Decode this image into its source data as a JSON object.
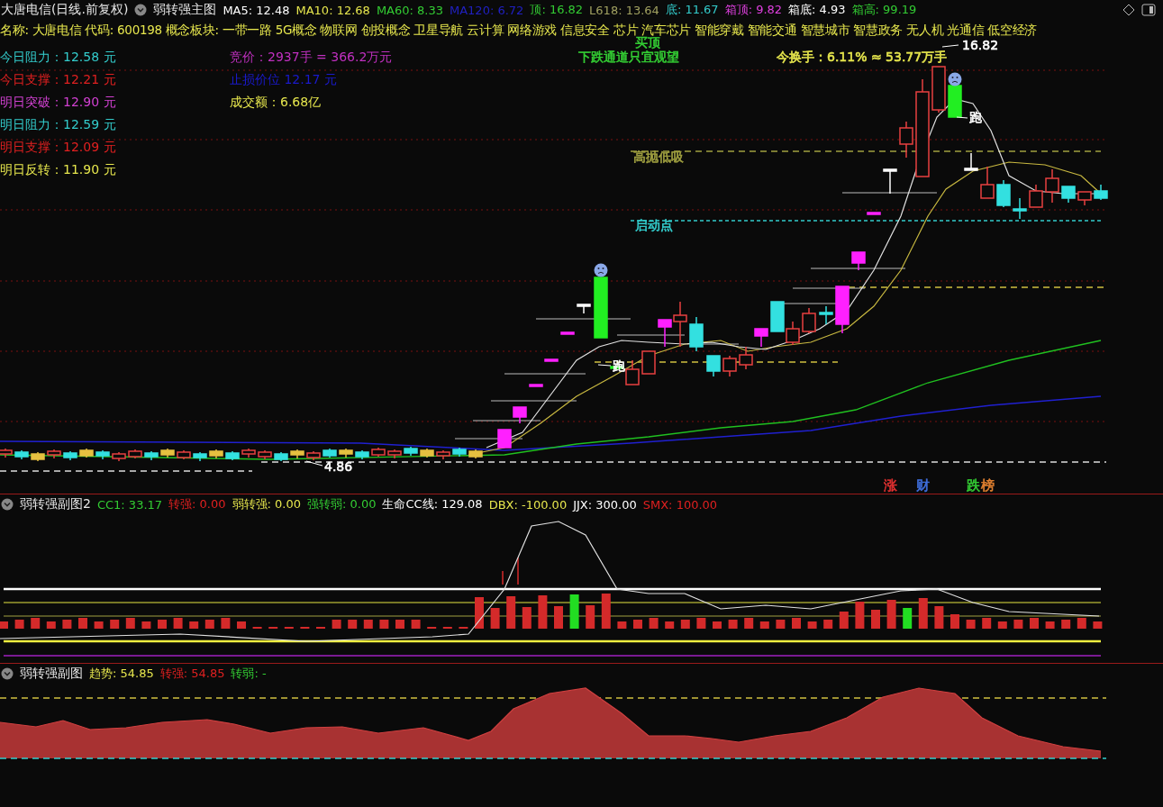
{
  "main_chart": {
    "header": {
      "stock": "大唐电信(日线.前复权)",
      "indicator": "弱转强主图",
      "values": [
        {
          "text": "MA5: 12.48",
          "color": "#ffffff"
        },
        {
          "text": "MA10: 12.68",
          "color": "#e6e64d"
        },
        {
          "text": "MA60: 8.33",
          "color": "#33cc33"
        },
        {
          "text": "MA120: 6.72",
          "color": "#2020c0"
        },
        {
          "text": "顶: 16.82",
          "color": "#33cc33"
        },
        {
          "text": "L618: 13.64",
          "color": "#a0a060"
        },
        {
          "text": "底: 11.67",
          "color": "#33cccc"
        },
        {
          "text": "箱顶: 9.82",
          "color": "#e040e0"
        },
        {
          "text": "箱底: 4.93",
          "color": "#ffffff"
        },
        {
          "text": "箱高: 99.19",
          "color": "#33cc33"
        }
      ]
    },
    "info_line": "名称: 大唐电信 代码: 600198 概念板块: 一带一路 5G概念 物联网 创投概念 卫星导航 云计算 网络游戏 信息安全 芯片 汽车芯片 智能穿戴 智能交通 智慧城市 智慧政务 无人机 光通信 低空经济",
    "price_levels": [
      {
        "text": "今日阻力：12.58 元",
        "color": "#33cccc"
      },
      {
        "text": "今日支撑：12.21 元",
        "color": "#e02020"
      },
      {
        "text": "明日突破：12.90 元",
        "color": "#d040d0"
      },
      {
        "text": "明日阻力：12.59 元",
        "color": "#33cccc"
      },
      {
        "text": "明日支撑：12.09 元",
        "color": "#e02020"
      },
      {
        "text": "明日反转：11.90 元",
        "color": "#e6e64d"
      }
    ],
    "trade_info": [
      {
        "text": "竞价：2937手 = 366.2万元",
        "color": "#c030c0"
      },
      {
        "text": "止损价位 12.17 元",
        "color": "#1a1acc"
      },
      {
        "text": "成交额：6.68亿",
        "color": "#e6e64d"
      }
    ],
    "annotations": [
      {
        "text": "买顶",
        "color": "#33cc33"
      },
      {
        "text": "下跌通道只宜观望",
        "color": "#33cc33"
      },
      {
        "text": "今换手：6.11% ≈ 53.77万手",
        "color": "#e6e64d"
      },
      {
        "text": "16.82",
        "color": "#ffffff"
      },
      {
        "text": "跑",
        "color": "#ffffff"
      },
      {
        "text": "高抛低吸",
        "color": "#a0a040"
      },
      {
        "text": "启动点",
        "color": "#33cccc"
      },
      {
        "text": "跑",
        "color": "#ffffff"
      },
      {
        "text": "4.86",
        "color": "#ffffff"
      }
    ],
    "badges": [
      {
        "text": "涨",
        "color": "#e03030"
      },
      {
        "text": "财",
        "color": "#4070e0"
      },
      {
        "text": "跌",
        "color": "#33cc33"
      },
      {
        "text": "榜",
        "color": "#e08030"
      }
    ]
  },
  "sub_chart_1": {
    "title": "弱转强副图2",
    "values": [
      {
        "text": "CC1: 33.17",
        "color": "#33cc33"
      },
      {
        "text": "转强: 0.00",
        "color": "#e02020"
      },
      {
        "text": "弱转强: 0.00",
        "color": "#e6e64d"
      },
      {
        "text": "强转弱: 0.00",
        "color": "#33cc33"
      },
      {
        "text": "生命CC线: 129.08",
        "color": "#ffffff"
      },
      {
        "text": "DBX: -100.00",
        "color": "#e6e64d"
      },
      {
        "text": "JJX: 300.00",
        "color": "#ffffff"
      },
      {
        "text": "SMX: 100.00",
        "color": "#e02020"
      }
    ]
  },
  "sub_chart_2": {
    "title": "弱转强副图",
    "values": [
      {
        "text": "趋势: 54.85",
        "color": "#e6e64d"
      },
      {
        "text": "转强: 54.85",
        "color": "#e02020"
      },
      {
        "text": "转弱: -",
        "color": "#33cc33"
      }
    ]
  }
}
